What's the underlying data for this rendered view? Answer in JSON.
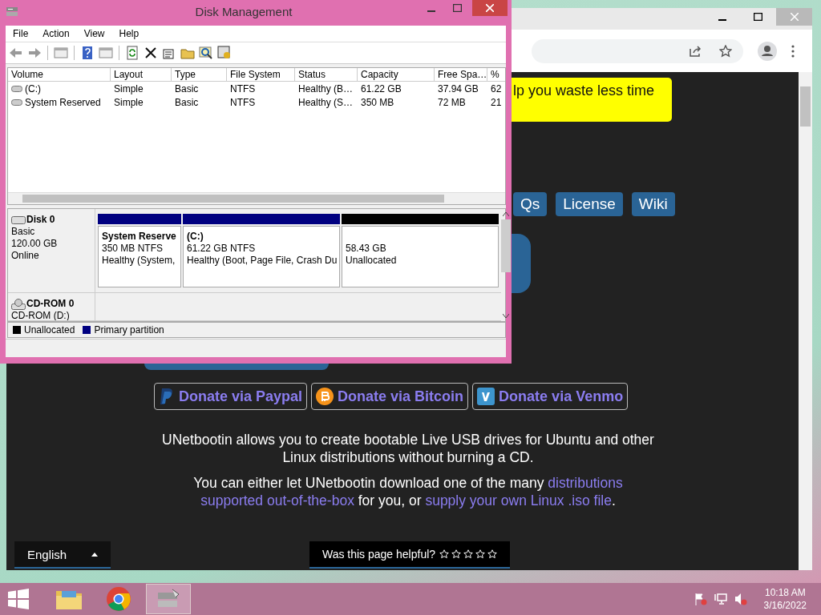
{
  "disk_window": {
    "title": "Disk Management",
    "menu": [
      "File",
      "Action",
      "View",
      "Help"
    ],
    "volumes": {
      "columns": [
        "Volume",
        "Layout",
        "Type",
        "File System",
        "Status",
        "Capacity",
        "Free Spa…",
        "%"
      ],
      "rows": [
        [
          "(C:)",
          "Simple",
          "Basic",
          "NTFS",
          "Healthy (B…",
          "61.22 GB",
          "37.94 GB",
          "62"
        ],
        [
          "System Reserved",
          "Simple",
          "Basic",
          "NTFS",
          "Healthy (S…",
          "350 MB",
          "72 MB",
          "21"
        ]
      ]
    },
    "disks": [
      {
        "kind": "disk",
        "name": "Disk 0",
        "lines": [
          "Basic",
          "120.00 GB",
          "Online"
        ],
        "partitions": [
          {
            "kind": "primary",
            "title": "System Reserve",
            "lines": [
              "350 MB NTFS",
              "Healthy (System,"
            ]
          },
          {
            "kind": "primary",
            "title": "(C:)",
            "lines": [
              "61.22 GB NTFS",
              "Healthy (Boot, Page File, Crash Du"
            ]
          },
          {
            "kind": "unallocated",
            "lines": [
              "58.43 GB",
              "Unallocated"
            ]
          }
        ]
      },
      {
        "kind": "cdrom",
        "name": "CD-ROM 0",
        "lines": [
          "CD-ROM (D:)"
        ]
      }
    ],
    "legend": [
      {
        "label": "Unallocated",
        "color": "#000000"
      },
      {
        "label": "Primary partition",
        "color": "#000080"
      }
    ]
  },
  "browser": {
    "banner": "lp you waste less time",
    "nav": [
      "Qs",
      "License",
      "Wiki"
    ],
    "donate": [
      {
        "kind": "paypal",
        "label": "Donate via Paypal"
      },
      {
        "kind": "bitcoin",
        "label": "Donate via Bitcoin"
      },
      {
        "kind": "venmo",
        "label": "Donate via Venmo"
      }
    ],
    "intro": "UNetbootin allows you to create bootable Live USB drives for Ubuntu and other Linux distributions without burning a CD.",
    "para": [
      {
        "text": "You can either let UNetbootin download one of the many ",
        "link": false
      },
      {
        "text": "distributions",
        "link": true
      },
      {
        "text": "supported out-of-the-box",
        "link": true
      },
      {
        "text": " for you, or ",
        "link": false
      },
      {
        "text": "supply your own Linux .iso file",
        "link": true
      },
      {
        "text": ".",
        "link": false
      }
    ],
    "language": "English",
    "feedback": {
      "question": "Was this page helpful?",
      "stars": 0
    }
  },
  "taskbar": {
    "apps": [
      {
        "kind": "explorer",
        "selected": false
      },
      {
        "kind": "chrome",
        "selected": false
      },
      {
        "kind": "disk",
        "selected": true
      }
    ],
    "time": "10:18 AM",
    "date": "3/16/2022"
  }
}
